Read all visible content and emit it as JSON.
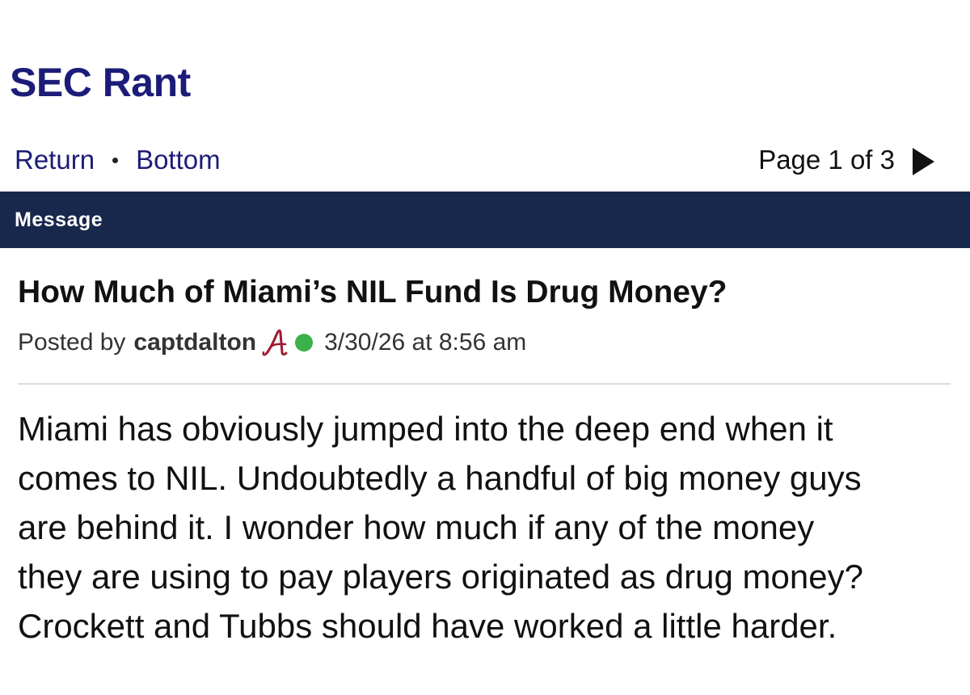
{
  "board": {
    "title": "SEC Rant"
  },
  "nav": {
    "return_label": "Return",
    "bottom_label": "Bottom",
    "pager_text": "Page 1 of 3",
    "next_icon": "next-page-triangle-icon"
  },
  "message_header": {
    "label": "Message"
  },
  "post": {
    "title": "How Much of Miami’s NIL Fund Is Drug Money?",
    "posted_by_label": "Posted by",
    "author": "captdalton",
    "team_icon": "alabama-script-a-icon",
    "online_status": "online",
    "online_color": "#3bb14a",
    "timestamp": "3/30/26 at 8:56 am",
    "body_lines": [
      "Miami has obviously jumped into the deep end when it",
      "comes to NIL. Undoubtedly a handful of big money guys",
      "are behind it. I wonder how much if any of the money",
      "they are using to pay players originated as drug money?",
      "Crockett and Tubbs should have worked a little harder."
    ]
  },
  "colors": {
    "title_blue": "#1c1c78",
    "header_navy": "#17284c",
    "alabama_crimson": "#9e1b32"
  }
}
